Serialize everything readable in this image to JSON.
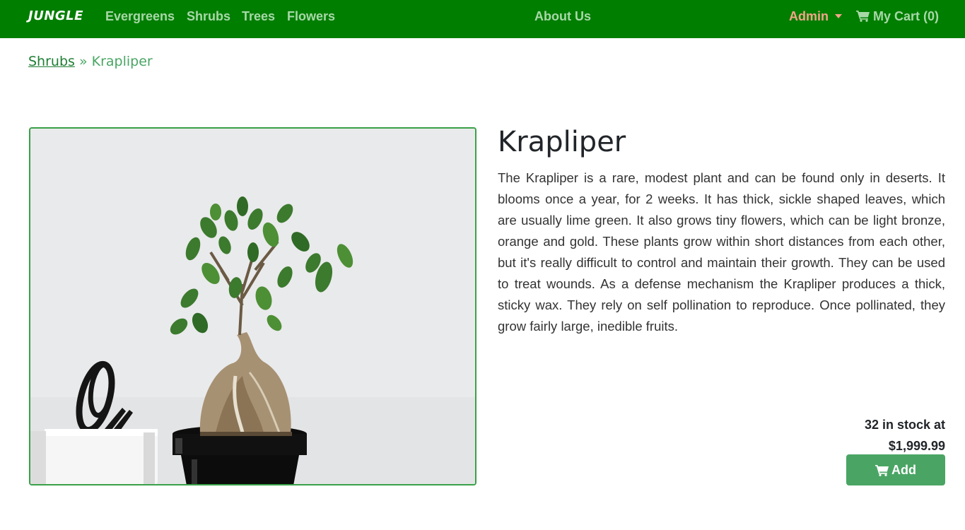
{
  "navbar": {
    "brand": "JUNGLE",
    "categories": [
      "Evergreens",
      "Shrubs",
      "Trees",
      "Flowers"
    ],
    "about": "About Us",
    "admin": "Admin",
    "cart": "My Cart (0)",
    "colors": {
      "background": "#007e00",
      "link": "#a8d8a8",
      "admin": "#f4a48a"
    }
  },
  "breadcrumb": {
    "parent": "Shrubs",
    "separator": "»",
    "current": "Krapliper"
  },
  "product": {
    "name": "Krapliper",
    "image_alt": "bonsai-tree-in-black-pot",
    "description": "The Krapliper is a rare, modest plant and can be found only in deserts. It blooms once a year, for 2 weeks. It has thick, sickle shaped leaves, which are usually lime green. It also grows tiny flowers, which can be light bronze, orange and gold. These plants grow within short distances from each other, but it's really difficult to control and maintain their growth. They can be used to treat wounds. As a defense mechanism the Krapliper produces a thick, sticky wax. They rely on self pollination to reproduce. Once pollinated, they grow fairly large, inedible fruits.",
    "stock_text": "32 in stock at",
    "price": "$1,999.99",
    "add_label": "Add"
  }
}
